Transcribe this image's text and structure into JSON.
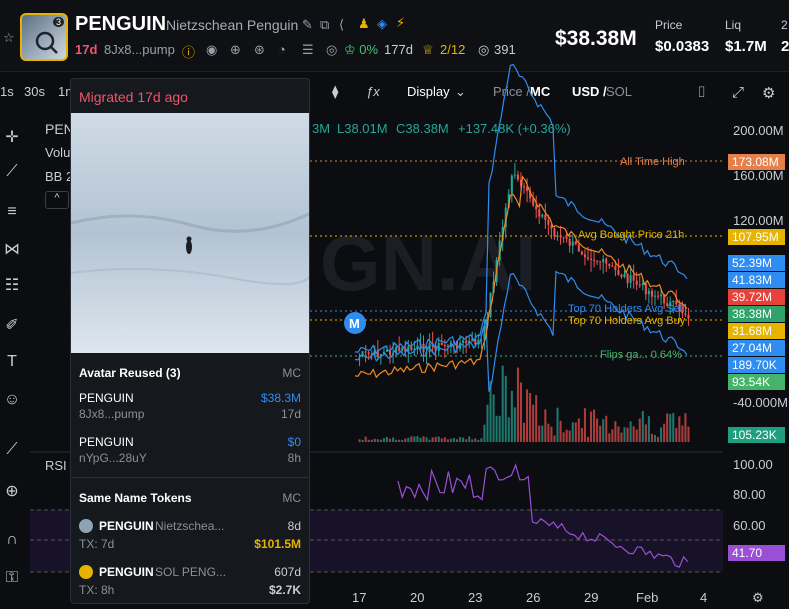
{
  "token": {
    "symbol": "PENGUIN",
    "name": "Nietzschean Penguin",
    "age": "17d",
    "address": "8Jx8...pump",
    "logo_count": "3",
    "holders_pct": "0%",
    "holders_age": "177d",
    "crown_count": "2/12",
    "views": "391"
  },
  "header_stats": {
    "market_cap": "$38.38M",
    "price_label": "Price",
    "price_value": "$0.0383",
    "liq_label": "Liq",
    "liq_value": "$1.7M",
    "extra_label": "2",
    "extra_value": "2"
  },
  "toolbar": {
    "timeframes": [
      "1s",
      "30s",
      "1m"
    ],
    "display_label": "Display",
    "price_mc_a": "Price /",
    "price_mc_b": "MC",
    "usd_sol_a": "USD /",
    "usd_sol_b": "SOL"
  },
  "ohlc": {
    "prefix": "PEN",
    "m_value": "3M",
    "low": "L38.01M",
    "close": "C38.38M",
    "change": "+137.48K (+0.36%)",
    "volume_label": "Volu",
    "bb_label": "BB 2"
  },
  "popup": {
    "title": "Migrated 17d ago",
    "avatar_reused_label": "Avatar Reused (3)",
    "mc_label": "MC",
    "reused": [
      {
        "symbol": "PENGUIN",
        "addr": "8Jx8...pump",
        "mc": "$38.3M",
        "age": "17d"
      },
      {
        "symbol": "PENGUIN",
        "addr": "nYpG...28uY",
        "mc": "$0",
        "age": "8h"
      }
    ],
    "same_name_label": "Same Name Tokens",
    "same": [
      {
        "symbol": "PENGUIN",
        "name": "Nietzschea...",
        "tx": "TX: 7d",
        "mc": "$101.5M",
        "age": "8d"
      },
      {
        "symbol": "PENGUIN",
        "name": "SOL PENG...",
        "tx": "TX: 8h",
        "mc": "$2.7K",
        "age": "607d"
      }
    ]
  },
  "annotations": {
    "ath": "All Time High",
    "avg_bought": "Avg Bought Price 21h",
    "top70_sell": "Top 70 Holders Avg Sell",
    "top70_buy": "Top 70 Holders Avg Buy",
    "flips": "Flips ga... 0.64%",
    "watermark": "GN.AI",
    "rsi_label": "RSI",
    "marker": "M"
  },
  "y_axis_main": [
    "200.00M",
    "160.00M",
    "120.00M",
    "-40.000M"
  ],
  "y_axis_rsi": [
    "100.00",
    "80.00",
    "60.00"
  ],
  "price_badges": [
    {
      "text": "173.08M",
      "color": "#e6804a"
    },
    {
      "text": "107.95M",
      "color": "#e6b300"
    },
    {
      "text": "52.39M",
      "color": "#2f8cf0"
    },
    {
      "text": "41.83M",
      "color": "#2f8cf0"
    },
    {
      "text": "39.72M",
      "color": "#e8413a"
    },
    {
      "text": "38.38M",
      "color": "#2fa36a"
    },
    {
      "text": "31.68M",
      "color": "#e6b300"
    },
    {
      "text": "27.04M",
      "color": "#2f8cf0"
    },
    {
      "text": "189.70K",
      "color": "#2f8cf0"
    },
    {
      "text": "93.54K",
      "color": "#46b36a"
    },
    {
      "text": "105.23K",
      "color": "#1f9e80"
    },
    {
      "text": "41.70",
      "color": "#9a4fd6"
    }
  ],
  "x_axis": [
    "17",
    "20",
    "23",
    "26",
    "29",
    "Feb",
    "4"
  ],
  "colors": {
    "up": "#26a69a",
    "down": "#ef5350",
    "bb": "#2f8cf0",
    "ma": "#f08a24",
    "rsi": "#9a4fd6"
  }
}
